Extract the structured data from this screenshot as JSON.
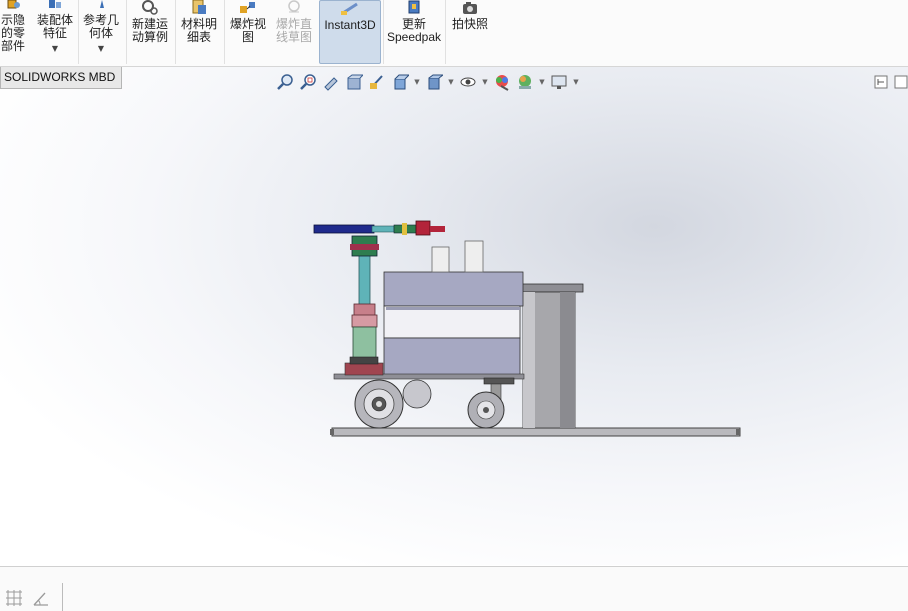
{
  "ribbon": {
    "buttons": [
      {
        "id": "show-hide-components",
        "label": "示隐\n的零\n部件",
        "icon": "show-hide-components-icon",
        "has_menu": false
      },
      {
        "id": "assembly-features",
        "label": "装配体\n特征",
        "icon": "assembly-features-icon",
        "has_menu": true
      },
      {
        "id": "reference-geometry",
        "label": "参考几\n何体",
        "icon": "reference-geometry-icon",
        "has_menu": true
      },
      {
        "id": "new-motion-study",
        "label": "新建运\n动算例",
        "icon": "motion-study-icon",
        "has_menu": false
      },
      {
        "id": "bill-of-materials",
        "label": "材料明\n细表",
        "icon": "bill-of-materials-icon",
        "has_menu": false
      },
      {
        "id": "exploded-view",
        "label": "爆炸视\n图",
        "icon": "exploded-view-icon",
        "has_menu": false
      },
      {
        "id": "explode-line-sketch",
        "label": "爆炸直\n线草图",
        "icon": "explode-line-sketch-icon",
        "has_menu": false,
        "disabled": true
      },
      {
        "id": "instant3d",
        "label": "Instant3D",
        "icon": "instant3d-icon",
        "has_menu": false,
        "active": true
      },
      {
        "id": "update-speedpak",
        "label": "更新\nSpeedpak",
        "icon": "speedpak-icon",
        "has_menu": false
      },
      {
        "id": "take-snapshot",
        "label": "拍快照",
        "icon": "camera-icon",
        "has_menu": false
      }
    ]
  },
  "tabs": {
    "mbd": "SOLIDWORKS MBD"
  },
  "heads_up_toolbar": {
    "icons": [
      "zoom-to-fit-icon",
      "zoom-to-area-icon",
      "previous-view-icon",
      "section-view-icon",
      "dynamic-annotation-icon",
      "view-orientation-icon",
      "display-style-icon",
      "hide-show-items-icon",
      "edit-appearance-icon",
      "apply-scene-icon",
      "view-settings-icon"
    ]
  },
  "colors": {
    "accent_active": "#cfdceb",
    "body_gray": "#a6a8c2",
    "handle_blue": "#1f2a8c",
    "handle_red": "#b3243a",
    "spring_pink": "#c77f8a",
    "shaft_teal": "#5fb3b8"
  }
}
